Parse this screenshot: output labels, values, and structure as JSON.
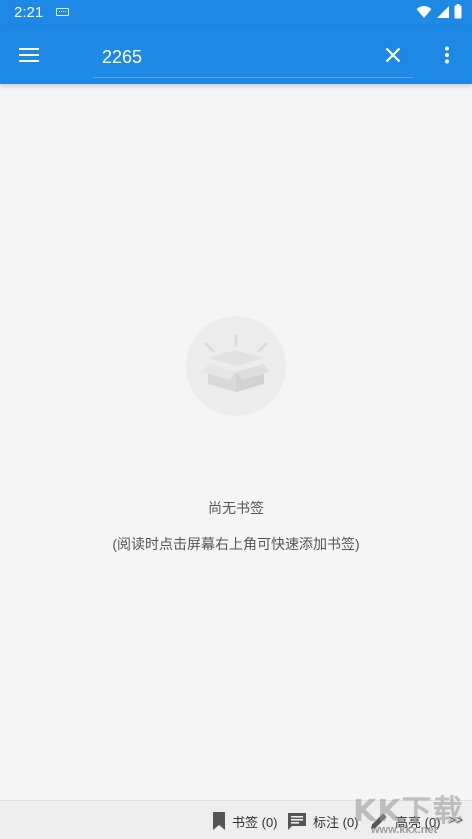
{
  "status_bar": {
    "time": "2:21"
  },
  "toolbar": {
    "search_value": "2265"
  },
  "empty_state": {
    "title": "尚无书签",
    "hint": "(阅读时点击屏幕右上角可快速添加书签)"
  },
  "bottom_tabs": [
    {
      "label": "书签 (0)",
      "icon": "bookmark-icon"
    },
    {
      "label": "标注 (0)",
      "icon": "comment-icon"
    },
    {
      "label": "高亮 (0)",
      "icon": "pencil-icon"
    }
  ],
  "more_label": ">>",
  "watermark": {
    "big": "KK下载",
    "small": "www.kkx.net"
  },
  "colors": {
    "primary": "#1e88e5",
    "background": "#f5f5f5",
    "bottom_bar": "#eeeeee"
  }
}
